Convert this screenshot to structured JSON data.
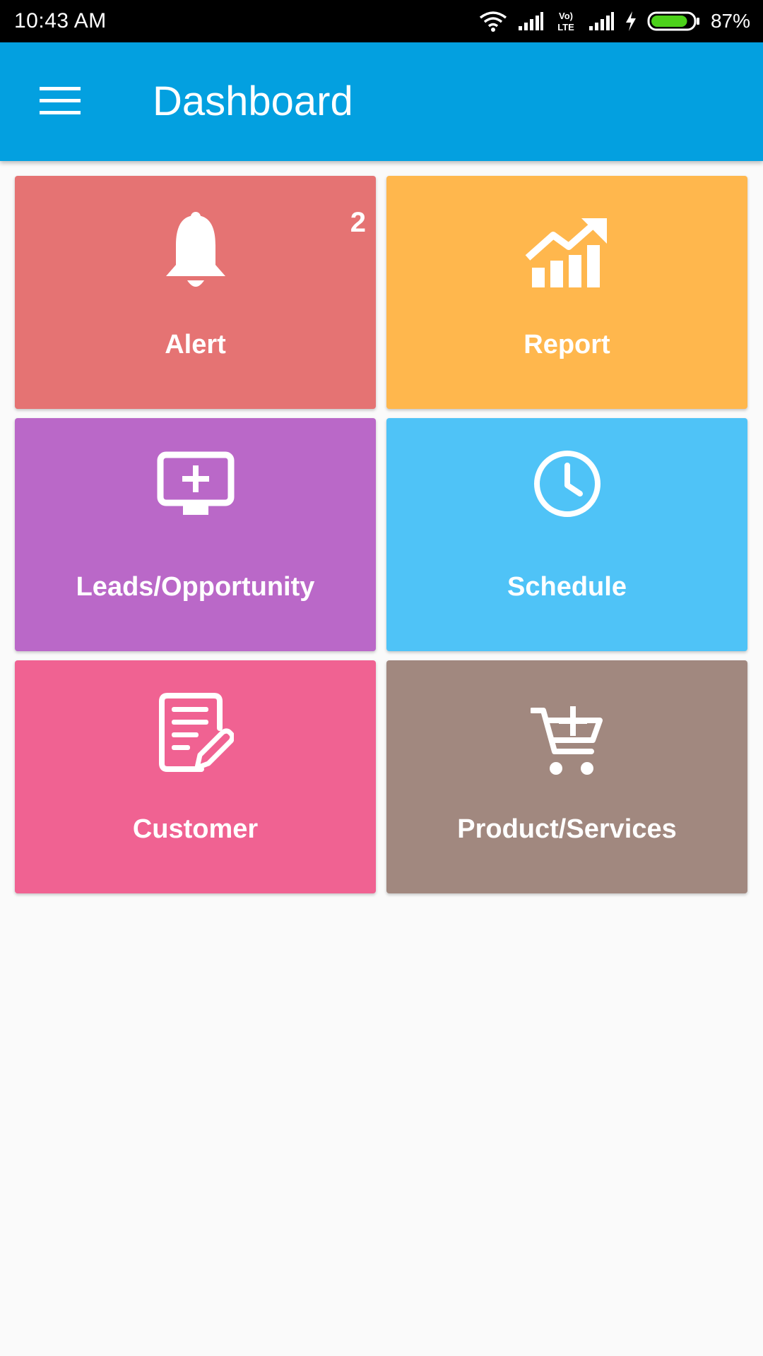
{
  "status_bar": {
    "time": "10:43 AM",
    "network_label": "Vo) LTE",
    "battery": "87%",
    "icons": [
      "wifi-icon",
      "signal-icon",
      "volte-icon",
      "signal-icon",
      "charging-icon",
      "battery-icon"
    ],
    "battery_level_percent": 87,
    "battery_color": "#4cd11a"
  },
  "app_bar": {
    "title": "Dashboard",
    "menu_icon": "hamburger-menu-icon",
    "background": "#03a0e0"
  },
  "tiles": [
    {
      "label": "Alert",
      "badge": "2",
      "icon": "bell-icon",
      "color": "#e57373"
    },
    {
      "label": "Report",
      "icon": "trending-chart-icon",
      "color": "#ffb74d"
    },
    {
      "label": "Leads/Opportunity",
      "icon": "monitor-plus-icon",
      "color": "#ba68c8"
    },
    {
      "label": "Schedule",
      "icon": "clock-icon",
      "color": "#4fc3f7"
    },
    {
      "label": "Customer",
      "icon": "document-edit-icon",
      "color": "#f06292"
    },
    {
      "label": "Product/Services",
      "icon": "cart-plus-icon",
      "color": "#a1887f"
    }
  ],
  "page": {
    "background": "#fafafa"
  }
}
